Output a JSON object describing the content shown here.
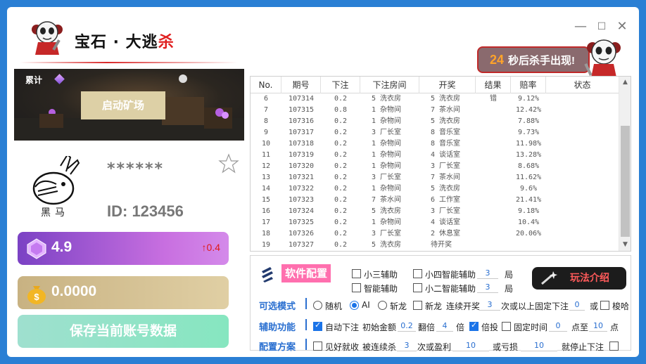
{
  "app": {
    "title_main": "宝石 · 大逃",
    "title_red": "杀",
    "countdown_seconds": "24",
    "countdown_text": "秒后杀手出现!",
    "window_minimize": "—",
    "window_maximize": "☐",
    "window_close": "✕"
  },
  "scene": {
    "label": "累计",
    "start_button": "启动矿场"
  },
  "profile": {
    "avatar_name": "黑马",
    "masked": "******",
    "id_text": "ID: 123456"
  },
  "balances": {
    "gem_value": "4.9",
    "gem_change": "↑0.4",
    "coin_value": "0.0000",
    "save_button": "保存当前账号数据"
  },
  "table": {
    "headers": [
      "No.",
      "期号",
      "下注",
      "下注房间",
      "开奖",
      "结果",
      "赔率",
      "状态"
    ],
    "rows": [
      {
        "no": "6",
        "issue": "107314",
        "bet": "0.2",
        "room": "5 洗衣房",
        "draw": "5 洗衣房",
        "result": "错",
        "odds": "9.12%"
      },
      {
        "no": "7",
        "issue": "107315",
        "bet": "0.8",
        "room": "1 杂物间",
        "draw": "7 茶水间",
        "result": "",
        "odds": "12.42%"
      },
      {
        "no": "8",
        "issue": "107316",
        "bet": "0.2",
        "room": "1 杂物间",
        "draw": "5 洗衣房",
        "result": "",
        "odds": "7.88%"
      },
      {
        "no": "9",
        "issue": "107317",
        "bet": "0.2",
        "room": "3 厂长室",
        "draw": "8 音乐室",
        "result": "",
        "odds": "9.73%"
      },
      {
        "no": "10",
        "issue": "107318",
        "bet": "0.2",
        "room": "1 杂物间",
        "draw": "8 音乐室",
        "result": "",
        "odds": "11.98%"
      },
      {
        "no": "11",
        "issue": "107319",
        "bet": "0.2",
        "room": "1 杂物间",
        "draw": "4 谈话室",
        "result": "",
        "odds": "13.28%"
      },
      {
        "no": "12",
        "issue": "107320",
        "bet": "0.2",
        "room": "1 杂物间",
        "draw": "3 厂长室",
        "result": "",
        "odds": "8.68%"
      },
      {
        "no": "13",
        "issue": "107321",
        "bet": "0.2",
        "room": "3 厂长室",
        "draw": "7 茶水间",
        "result": "",
        "odds": "11.62%"
      },
      {
        "no": "14",
        "issue": "107322",
        "bet": "0.2",
        "room": "1 杂物间",
        "draw": "5 洗衣房",
        "result": "",
        "odds": "9.6%"
      },
      {
        "no": "15",
        "issue": "107323",
        "bet": "0.2",
        "room": "7 茶水间",
        "draw": "6 工作室",
        "result": "",
        "odds": "21.41%"
      },
      {
        "no": "16",
        "issue": "107324",
        "bet": "0.2",
        "room": "5 洗衣房",
        "draw": "3 厂长室",
        "result": "",
        "odds": "9.18%"
      },
      {
        "no": "17",
        "issue": "107325",
        "bet": "0.2",
        "room": "1 杂物间",
        "draw": "4 谈话室",
        "result": "",
        "odds": "10.4%"
      },
      {
        "no": "18",
        "issue": "107326",
        "bet": "0.2",
        "room": "3 厂长室",
        "draw": "2 休息室",
        "result": "",
        "odds": "20.06%"
      },
      {
        "no": "19",
        "issue": "107327",
        "bet": "0.2",
        "room": "5 洗衣房",
        "draw": "待开奖",
        "result": "",
        "odds": ""
      }
    ]
  },
  "config": {
    "title": "软件配置",
    "help_button": "玩法介绍",
    "opt_small3": "小三辅助",
    "opt_small4": "小四智能辅助",
    "small4_value": "3",
    "unit_ju": "局",
    "opt_smart": "智能辅助",
    "opt_small2": "小二智能辅助",
    "small2_value": "3",
    "label_mode": "可选模式",
    "mode_random": "随机",
    "mode_ai": "AI",
    "mode_dragon": "斩龙",
    "opt_new_dragon": "新龙",
    "opt_streak": "连续开奖",
    "streak_value": "3",
    "streak_text": "次或以上固定下注",
    "fixed_value": "0",
    "or_text": "或",
    "opt_rust": "梭哈",
    "label_assist": "辅助功能",
    "opt_auto": "自动下注",
    "initial_amount_text": "初始金额",
    "initial_amount_value": "0.2",
    "multiply_text": "翻倍",
    "multiply_value": "4",
    "bei": "倍",
    "opt_double": "倍投",
    "opt_fixed_time": "固定时间",
    "time_from": "0",
    "time_to_text": "点至",
    "time_to": "10",
    "dian": "点",
    "label_plan": "配置方案",
    "opt_take_profit": "见好就收",
    "killed_text": "被连续杀",
    "killed_value": "3",
    "profit_text": "次或盈利",
    "profit_value": "10",
    "loss_text": "或亏损",
    "loss_value": "10",
    "stop_text": "就停止下注"
  }
}
